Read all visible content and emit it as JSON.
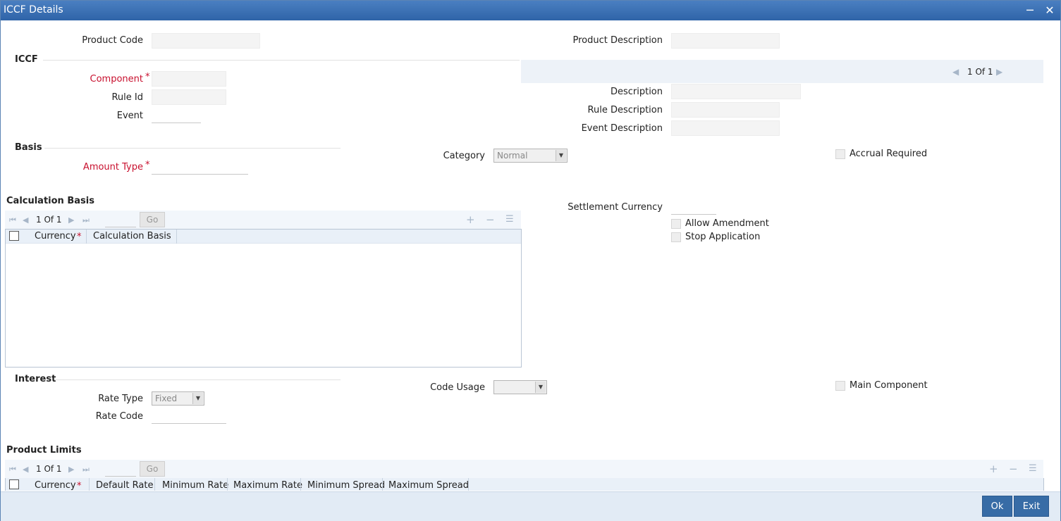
{
  "window": {
    "title": "ICCF Details",
    "minimize_icon": "minimize-icon",
    "close_icon": "close-icon"
  },
  "header": {
    "product_code_label": "Product Code",
    "product_code_value": "",
    "product_description_label": "Product Description",
    "product_description_value": ""
  },
  "iccf": {
    "section_label": "ICCF",
    "component_label": "Component",
    "component_required": "*",
    "rule_id_label": "Rule Id",
    "event_label": "Event",
    "pager_text": "1 Of 1",
    "description_label": "Description",
    "rule_description_label": "Rule Description",
    "event_description_label": "Event Description"
  },
  "basis": {
    "section_label": "Basis",
    "amount_type_label": "Amount Type",
    "amount_type_required": "*",
    "category_label": "Category",
    "category_value": "Normal",
    "accrual_required_label": "Accrual Required"
  },
  "calculation_basis": {
    "section_label": "Calculation Basis",
    "pager_text": "1 Of 1",
    "go_label": "Go",
    "columns": [
      "Currency",
      "Calculation Basis"
    ],
    "currency_required": "*"
  },
  "settlement": {
    "settlement_currency_label": "Settlement Currency",
    "allow_amendment_label": "Allow Amendment",
    "stop_application_label": "Stop Application"
  },
  "interest": {
    "section_label": "Interest",
    "rate_type_label": "Rate Type",
    "rate_type_value": "Fixed",
    "rate_code_label": "Rate Code",
    "code_usage_label": "Code Usage",
    "code_usage_value": "",
    "main_component_label": "Main Component"
  },
  "product_limits": {
    "section_label": "Product Limits",
    "pager_text": "1 Of 1",
    "go_label": "Go",
    "columns": [
      "Currency",
      "Default Rate",
      "Minimum Rate",
      "Maximum Rate",
      "Minimum Spread",
      "Maximum Spread"
    ],
    "currency_required": "*"
  },
  "footer": {
    "ok_label": "Ok",
    "exit_label": "Exit"
  },
  "colors": {
    "title_bar": "#2f64a8",
    "required": "#c8102e",
    "button": "#376ca6"
  }
}
